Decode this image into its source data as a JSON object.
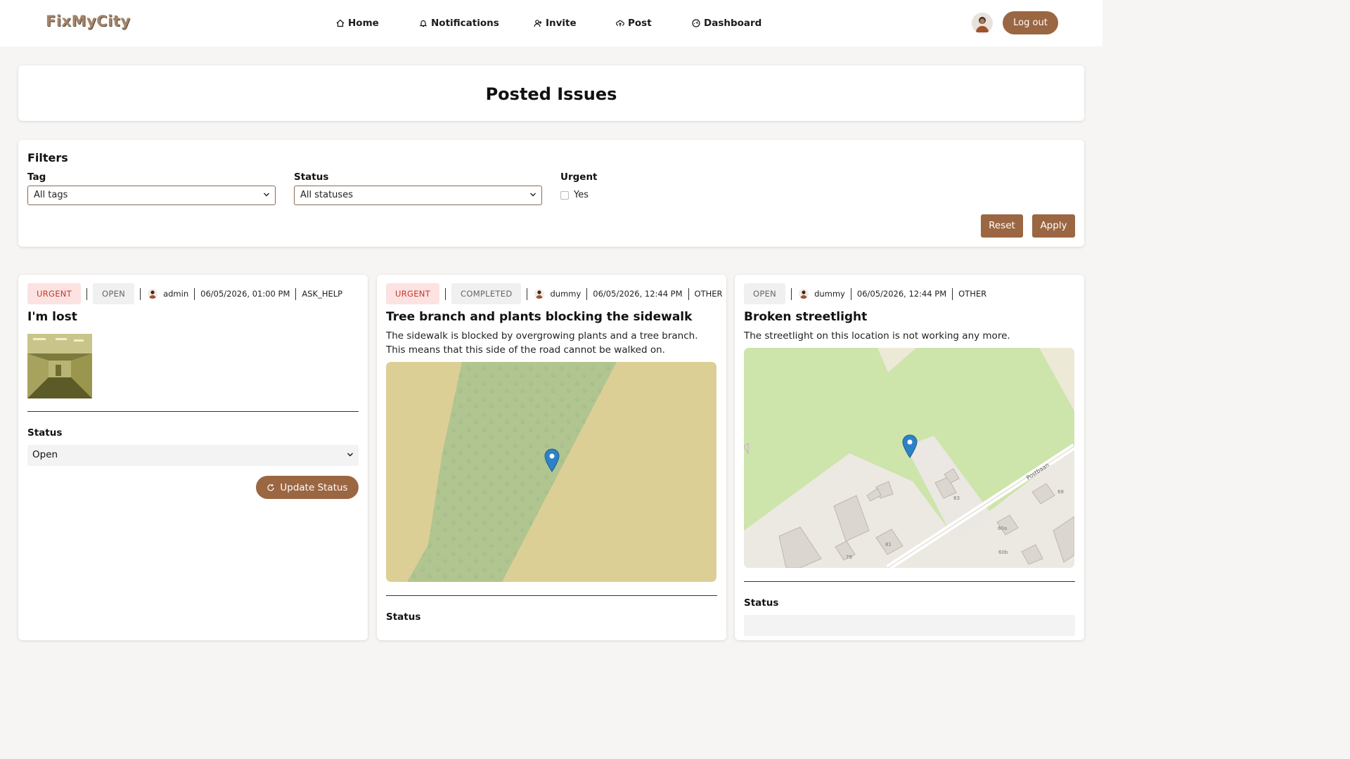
{
  "app": {
    "logo": "FixMyCity"
  },
  "nav": {
    "home": "Home",
    "notifications": "Notifications",
    "invite": "Invite",
    "post": "Post",
    "dashboard": "Dashboard",
    "logout": "Log out"
  },
  "page": {
    "title": "Posted Issues"
  },
  "filters": {
    "heading": "Filters",
    "tag_label": "Tag",
    "tag_value": "All tags",
    "status_label": "Status",
    "status_value": "All statuses",
    "urgent_label": "Urgent",
    "urgent_option": "Yes",
    "urgent_checked": false,
    "reset": "Reset",
    "apply": "Apply"
  },
  "issues": [
    {
      "urgent": "URGENT",
      "status": "OPEN",
      "user": "admin",
      "date": "06/05/2026, 01:00 PM",
      "tag": "ASK_HELP",
      "title": "I'm lost",
      "description": "",
      "status_label": "Status",
      "status_value": "Open",
      "update_button": "Update Status"
    },
    {
      "urgent": "URGENT",
      "status": "COMPLETED",
      "user": "dummy",
      "date": "06/05/2026, 12:44 PM",
      "tag": "OTHER",
      "title": "Tree branch and plants blocking the sidewalk",
      "description": "The sidewalk is blocked by overgrowing plants and a tree branch. This means that this side of the road cannot be walked on.",
      "status_label": "Status"
    },
    {
      "status": "OPEN",
      "user": "dummy",
      "date": "06/05/2026, 12:44 PM",
      "tag": "OTHER",
      "title": "Broken streetlight",
      "description": "The streetlight on this location is not working any more.",
      "status_label": "Status",
      "map_labels": {
        "street": "Postbaan",
        "h83": "83",
        "h81": "81",
        "h79": "79",
        "h60a": "60a",
        "h60b": "60b",
        "h68": "68"
      }
    }
  ],
  "colors": {
    "accent": "#9b6642",
    "urgent_bg": "#fde2e2",
    "urgent_text": "#c0392b"
  },
  "icons": [
    "home-icon",
    "bell-icon",
    "user-plus-icon",
    "cloud-upload-icon",
    "dashboard-icon",
    "chevron-down-icon",
    "refresh-icon",
    "map-pin-icon"
  ]
}
